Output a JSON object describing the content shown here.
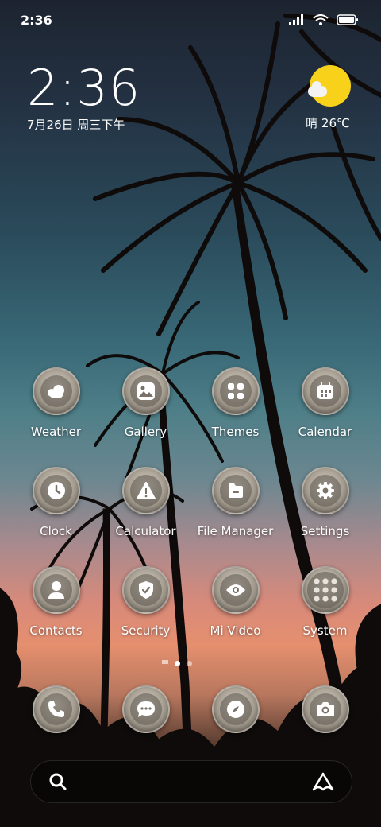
{
  "status_bar": {
    "time": "2:36"
  },
  "clock_widget": {
    "time": "2:36",
    "date": "7月26日 周三下午"
  },
  "weather_widget": {
    "text": "晴 26℃",
    "icon": "sunny-cloud-icon",
    "sun_color": "#f8d11b"
  },
  "apps": [
    {
      "label": "Weather",
      "icon": "weather-cloud-icon"
    },
    {
      "label": "Gallery",
      "icon": "gallery-image-icon"
    },
    {
      "label": "Themes",
      "icon": "themes-grid-icon"
    },
    {
      "label": "Calendar",
      "icon": "calendar-icon"
    },
    {
      "label": "Clock",
      "icon": "clock-icon"
    },
    {
      "label": "Calculator",
      "icon": "warning-triangle-icon"
    },
    {
      "label": "File Manager",
      "icon": "folder-icon"
    },
    {
      "label": "Settings",
      "icon": "gear-icon"
    },
    {
      "label": "Contacts",
      "icon": "contact-person-icon"
    },
    {
      "label": "Security",
      "icon": "shield-check-icon"
    },
    {
      "label": "Mi Video",
      "icon": "eye-icon"
    },
    {
      "label": "System",
      "icon": "folder-grid-icon"
    }
  ],
  "pager": {
    "page_count": 2,
    "current_page": 1
  },
  "dock": [
    {
      "icon": "phone-icon"
    },
    {
      "icon": "message-icon"
    },
    {
      "icon": "compass-icon"
    },
    {
      "icon": "camera-icon"
    }
  ],
  "search_bar": {
    "left_icon": "search-icon",
    "right_icon": "assistant-icon"
  }
}
